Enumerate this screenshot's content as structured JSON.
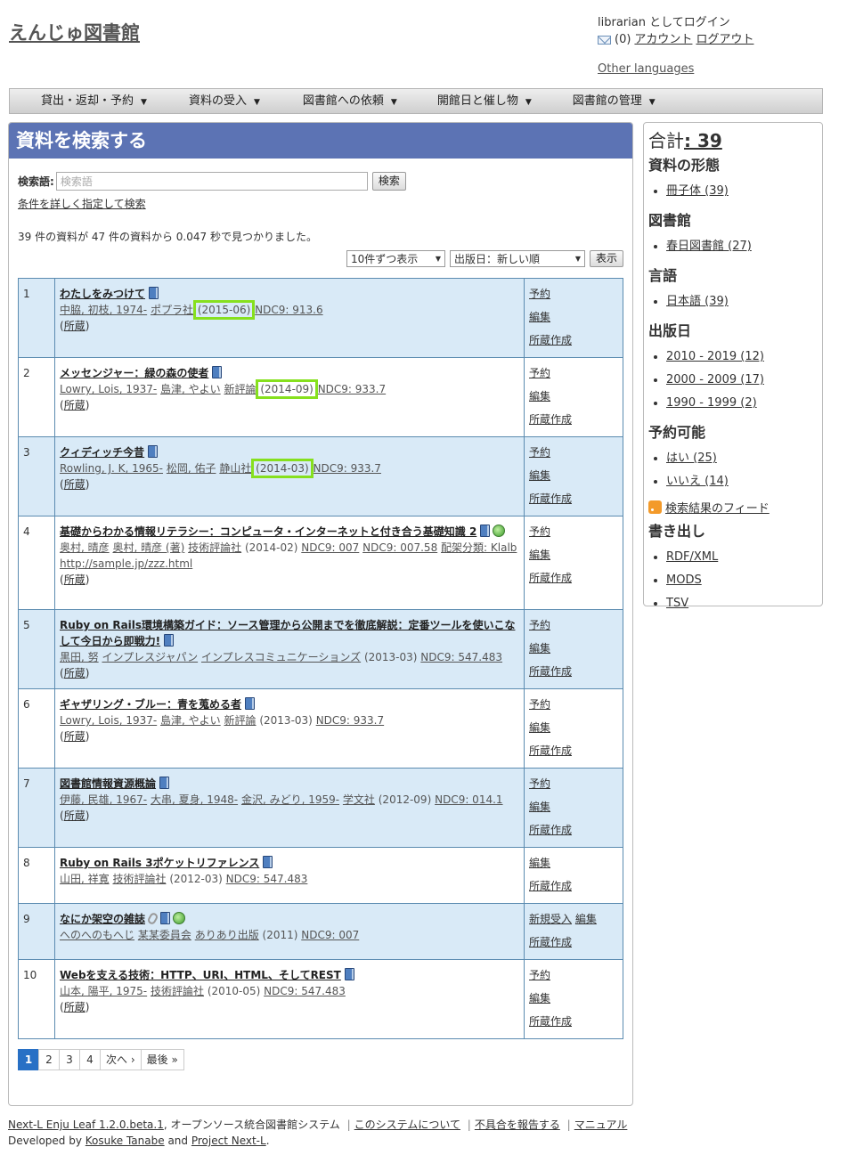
{
  "header": {
    "site_title": "えんじゅ図書館",
    "login_status": "librarian としてログイン",
    "message_count": "(0)",
    "account_link": "アカウント",
    "logout_link": "ログアウト",
    "other_languages": "Other languages"
  },
  "nav": [
    {
      "label": "貸出・返却・予約"
    },
    {
      "label": "資料の受入"
    },
    {
      "label": "図書館への依頼"
    },
    {
      "label": "開館日と催し物"
    },
    {
      "label": "図書館の管理"
    }
  ],
  "search": {
    "panel_title": "資料を検索する",
    "label": "検索語:",
    "placeholder": "検索語",
    "button": "検索",
    "advanced_link": "条件を詳しく指定して検索",
    "summary": "39 件の資料が 47 件の資料から 0.047 秒で見つかりました。",
    "per_page": "10件ずつ表示",
    "sort": "出版日：新しい順",
    "show_button": "表示"
  },
  "results": [
    {
      "num": "1",
      "title": "わたしをみつけて",
      "meta": [
        {
          "text": "中脇, 初枝, 1974-",
          "link": true
        },
        {
          "text": "ポプラ社",
          "link": true
        },
        {
          "text": "(2015-06)",
          "link": false,
          "hl": true
        },
        {
          "text": "NDC9: 913.6",
          "link": true
        }
      ],
      "holding": "所蔵",
      "actions": [
        "予約",
        "編集",
        "所蔵作成"
      ]
    },
    {
      "num": "2",
      "title": "メッセンジャー：緑の森の使者",
      "meta": [
        {
          "text": "Lowry, Lois, 1937-",
          "link": true
        },
        {
          "text": "島津, やよい",
          "link": true
        },
        {
          "text": "新評論",
          "link": true
        },
        {
          "text": "(2014-09)",
          "link": false,
          "hl": true
        },
        {
          "text": "NDC9: 933.7",
          "link": true
        }
      ],
      "holding": "所蔵",
      "actions": [
        "予約",
        "編集",
        "所蔵作成"
      ]
    },
    {
      "num": "3",
      "title": "クィディッチ今昔",
      "meta": [
        {
          "text": "Rowling, J. K, 1965-",
          "link": true
        },
        {
          "text": "松岡, 佑子",
          "link": true
        },
        {
          "text": "静山社",
          "link": true
        },
        {
          "text": "(2014-03)",
          "link": false,
          "hl": true
        },
        {
          "text": "NDC9: 933.7",
          "link": true
        }
      ],
      "holding": "所蔵",
      "actions": [
        "予約",
        "編集",
        "所蔵作成"
      ]
    },
    {
      "num": "4",
      "title": "基礎からわかる情報リテラシー：コンピュータ・インターネットと付き合う基礎知識 2",
      "globe": true,
      "meta": [
        {
          "text": "奥村, 晴彦",
          "link": true
        },
        {
          "text": "奥村, 晴彦 (著)",
          "link": true
        },
        {
          "text": "技術評論社",
          "link": true
        },
        {
          "text": "(2014-02)",
          "link": false
        },
        {
          "text": "NDC9: 007",
          "link": true
        },
        {
          "text": "NDC9: 007.58",
          "link": true
        },
        {
          "text": "配架分類: Klalb",
          "link": true
        },
        {
          "text": "http://sample.jp/zzz.html",
          "link": true
        }
      ],
      "holding": "所蔵",
      "actions": [
        "予約",
        "編集",
        "所蔵作成"
      ]
    },
    {
      "num": "5",
      "title": "Ruby on Rails環境構築ガイド：ソース管理から公開までを徹底解説：定番ツールを使いこなして今日から即戦力!",
      "meta": [
        {
          "text": "黒田, 努",
          "link": true
        },
        {
          "text": "インプレスジャパン",
          "link": true
        },
        {
          "text": "インプレスコミュニケーションズ",
          "link": true
        },
        {
          "text": "(2013-03)",
          "link": false
        },
        {
          "text": "NDC9: 547.483",
          "link": true
        }
      ],
      "holding": "所蔵",
      "actions": [
        "予約",
        "編集",
        "所蔵作成"
      ]
    },
    {
      "num": "6",
      "title": "ギャザリング・ブルー：青を蒐める者",
      "meta": [
        {
          "text": "Lowry, Lois, 1937-",
          "link": true
        },
        {
          "text": "島津, やよい",
          "link": true
        },
        {
          "text": "新評論",
          "link": true
        },
        {
          "text": "(2013-03)",
          "link": false
        },
        {
          "text": "NDC9: 933.7",
          "link": true
        }
      ],
      "holding": "所蔵",
      "actions": [
        "予約",
        "編集",
        "所蔵作成"
      ]
    },
    {
      "num": "7",
      "title": "図書館情報資源概論",
      "meta": [
        {
          "text": "伊藤, 民雄, 1967-",
          "link": true
        },
        {
          "text": "大串, 夏身, 1948-",
          "link": true
        },
        {
          "text": "金沢, みどり, 1959-",
          "link": true
        },
        {
          "text": "学文社",
          "link": true
        },
        {
          "text": "(2012-09)",
          "link": false
        },
        {
          "text": "NDC9: 014.1",
          "link": true
        }
      ],
      "holding": "所蔵",
      "actions": [
        "予約",
        "編集",
        "所蔵作成"
      ]
    },
    {
      "num": "8",
      "title": "Ruby on Rails 3ポケットリファレンス",
      "meta": [
        {
          "text": "山田, 祥寛",
          "link": true
        },
        {
          "text": "技術評論社",
          "link": true
        },
        {
          "text": "(2012-03)",
          "link": false
        },
        {
          "text": "NDC9: 547.483",
          "link": true
        }
      ],
      "holding": "",
      "actions": [
        "編集",
        "所蔵作成"
      ]
    },
    {
      "num": "9",
      "title": "なにか架空の雑誌",
      "clip": true,
      "globe": true,
      "meta": [
        {
          "text": "へのへのもへじ",
          "link": true
        },
        {
          "text": "某某委員会",
          "link": true
        },
        {
          "text": "ありあり出版",
          "link": true
        },
        {
          "text": "(2011)",
          "link": false
        },
        {
          "text": "NDC9: 007",
          "link": true
        }
      ],
      "holding": "",
      "actions_inline": [
        "新規受入",
        "編集"
      ],
      "actions": [
        "所蔵作成"
      ]
    },
    {
      "num": "10",
      "title": "Webを支える技術：HTTP、URI、HTML、そしてREST",
      "meta": [
        {
          "text": "山本, 陽平, 1975-",
          "link": true
        },
        {
          "text": "技術評論社",
          "link": true
        },
        {
          "text": "(2010-05)",
          "link": false
        },
        {
          "text": "NDC9: 547.483",
          "link": true
        }
      ],
      "holding": "所蔵",
      "actions": [
        "予約",
        "編集",
        "所蔵作成"
      ]
    }
  ],
  "pagination": {
    "pages": [
      "1",
      "2",
      "3",
      "4"
    ],
    "next": "次へ ›",
    "last": "最後 »"
  },
  "sidebar": {
    "total_label": "合計",
    "total_value": ": 39",
    "facets": [
      {
        "heading": "資料の形態",
        "items": [
          "冊子体 (39)"
        ]
      },
      {
        "heading": "図書館",
        "items": [
          "春日図書館 (27)"
        ]
      },
      {
        "heading": "言語",
        "items": [
          "日本語 (39)"
        ]
      },
      {
        "heading": "出版日",
        "items": [
          "2010 - 2019 (12)",
          "2000 - 2009 (17)",
          "1990 - 1999 (2)"
        ]
      },
      {
        "heading": "予約可能",
        "items": [
          "はい (25)",
          "いいえ (14)"
        ]
      }
    ],
    "feed_link": "検索結果のフィード",
    "export_heading": "書き出し",
    "export_items": [
      "RDF/XML",
      "MODS",
      "TSV"
    ]
  },
  "footer": {
    "product_link": "Next-L Enju Leaf 1.2.0.beta.1",
    "product_desc": ", オープンソース統合図書館システム",
    "about_link": "このシステムについて",
    "bug_link": "不具合を報告する",
    "manual_link": "マニュアル",
    "developed_by": "Developed by",
    "author": "Kosuke Tanabe",
    "and": "and",
    "project": "Project Next-L",
    "period": "."
  }
}
